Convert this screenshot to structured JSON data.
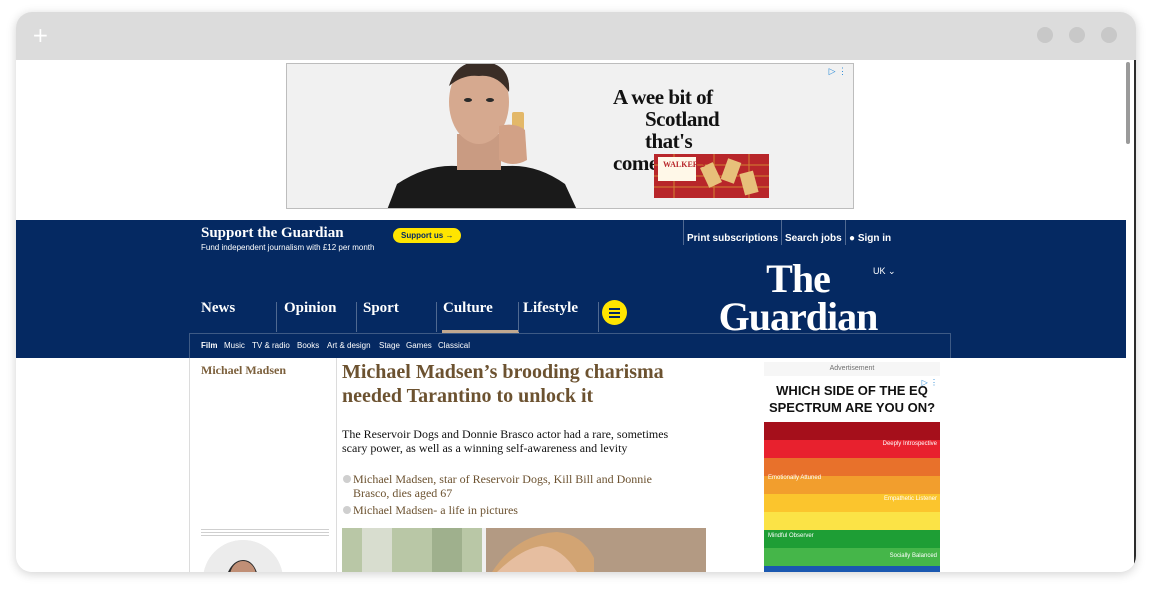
{
  "browser": {
    "new_tab_icon": "plus-icon"
  },
  "top_ad": {
    "headline_line1": "A wee bit of",
    "headline_line2": "Scotland that's",
    "headline_line3": "come a long way",
    "product_brand": "WALKER'S",
    "adchoices_icon": "ad-choices-icon"
  },
  "support": {
    "title": "Support the Guardian",
    "subtitle": "Fund independent journalism with £12 per month",
    "button_label": "Support us →",
    "print_subscriptions": "Print subscriptions",
    "search_jobs": "Search jobs",
    "sign_in": "Sign in"
  },
  "masthead": {
    "logo_line1": "The",
    "logo_line2": "Guardian",
    "edition": "UK",
    "pillars": [
      "News",
      "Opinion",
      "Sport",
      "Culture",
      "Lifestyle"
    ],
    "active_pillar": "Culture",
    "accent_yellow": "#ffe500",
    "brand_blue": "#052962"
  },
  "subnav": {
    "items": [
      "Film",
      "Music",
      "TV & radio",
      "Books",
      "Art & design",
      "Stage",
      "Games",
      "Classical"
    ],
    "active": "Film"
  },
  "article": {
    "byline": "Michael Madsen",
    "headline": "Michael Madsen’s brooding charisma needed Tarantino to unlock it",
    "standfirst": "The Reservoir Dogs and Donnie Brasco actor had a rare, sometimes scary power, as well as a winning self-awareness and levity",
    "related": [
      "Michael Madsen, star of Reservoir Dogs, Kill Bill and Donnie Brasco, dies aged 67",
      "Michael Madsen- a life in pictures"
    ],
    "accent_brown": "#6c5230"
  },
  "right_ad": {
    "label": "Advertisement",
    "question": "WHICH SIDE OF THE EQ SPECTRUM ARE YOU ON?",
    "bands": [
      "Deeply Introspective",
      "Emotionally Attuned",
      "Empathetic Listener",
      "Mindful Observer",
      "Socially Balanced"
    ]
  }
}
